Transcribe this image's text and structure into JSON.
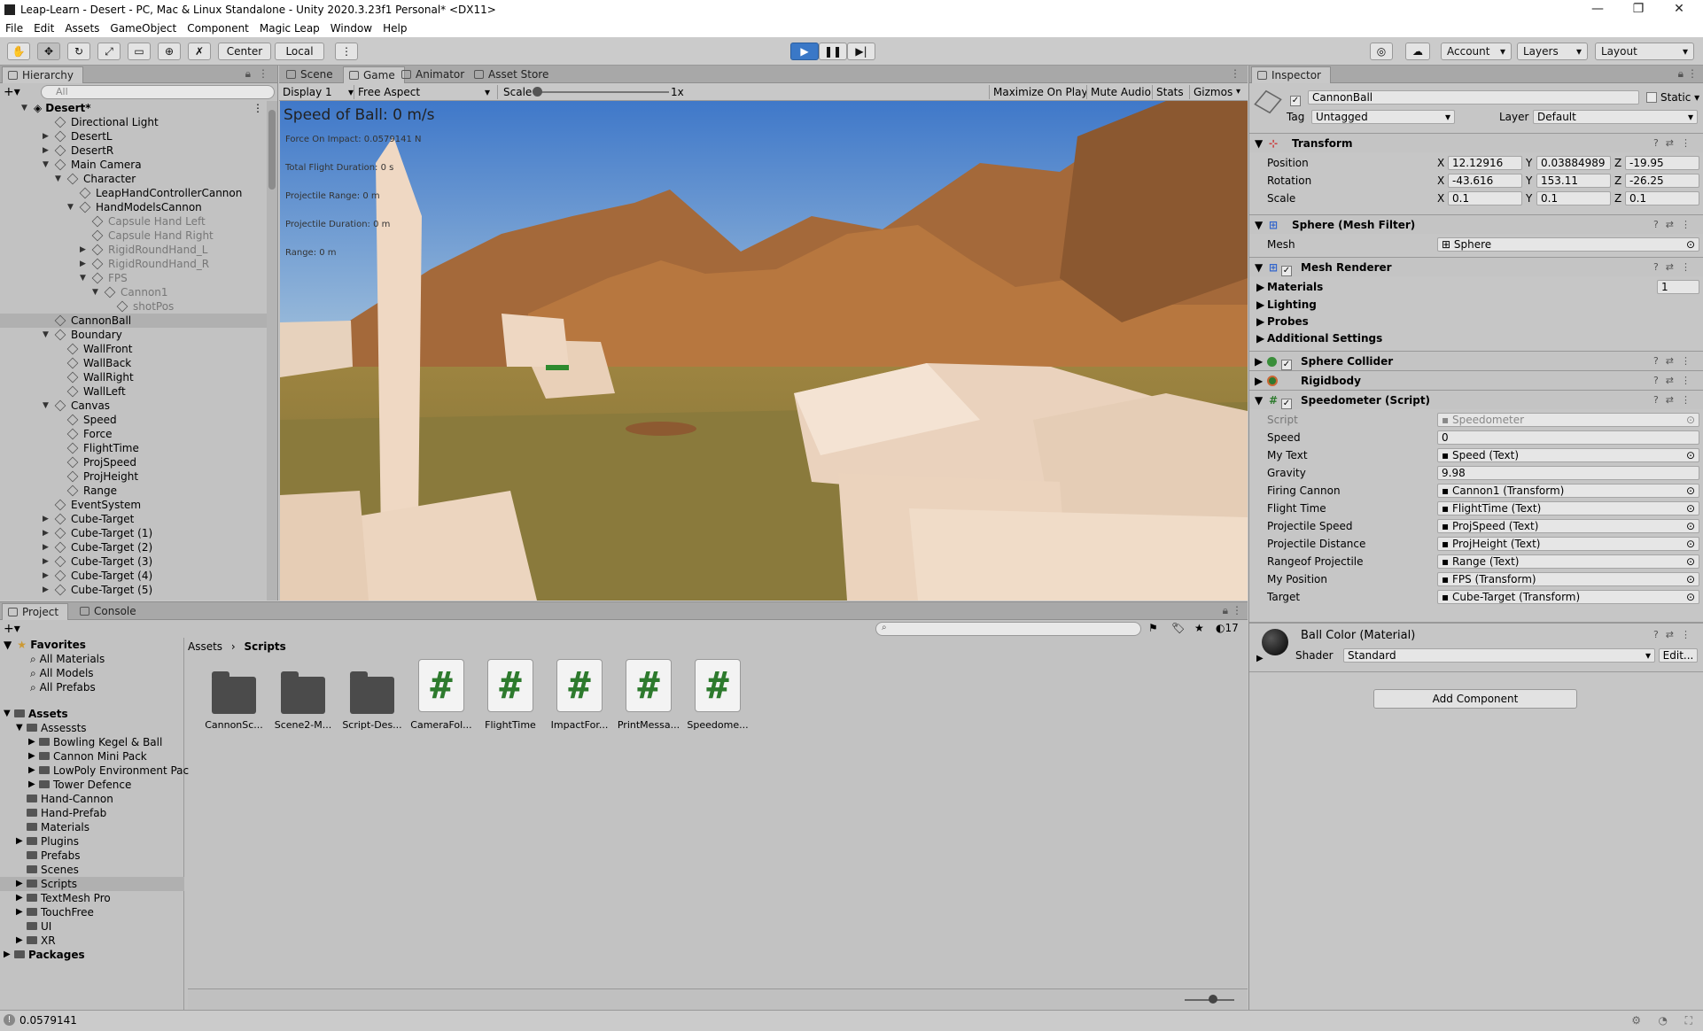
{
  "window": {
    "title": "Leap-Learn - Desert - PC, Mac & Linux Standalone - Unity 2020.3.23f1 Personal* <DX11>"
  },
  "menu": [
    "File",
    "Edit",
    "Assets",
    "GameObject",
    "Component",
    "Magic Leap",
    "Window",
    "Help"
  ],
  "toolbar": {
    "center": "Center",
    "local": "Local",
    "account": "Account",
    "layers": "Layers",
    "layout": "Layout"
  },
  "hierarchy": {
    "tab": "Hierarchy",
    "search_placeholder": "All",
    "rows": [
      {
        "label": "Desert*",
        "indent": 0,
        "bold": true,
        "arrow": "▼"
      },
      {
        "label": "Directional Light",
        "indent": 1
      },
      {
        "label": "DesertL",
        "indent": 1,
        "arrow": "▶"
      },
      {
        "label": "DesertR",
        "indent": 1,
        "arrow": "▶"
      },
      {
        "label": "Main Camera",
        "indent": 1,
        "arrow": "▼"
      },
      {
        "label": "Character",
        "indent": 2,
        "arrow": "▼"
      },
      {
        "label": "LeapHandControllerCannon",
        "indent": 3
      },
      {
        "label": "HandModelsCannon",
        "indent": 3,
        "arrow": "▼"
      },
      {
        "label": "Capsule Hand Left",
        "indent": 4,
        "grey": true
      },
      {
        "label": "Capsule Hand Right",
        "indent": 4,
        "grey": true
      },
      {
        "label": "RigidRoundHand_L",
        "indent": 4,
        "grey": true,
        "arrow": "▶"
      },
      {
        "label": "RigidRoundHand_R",
        "indent": 4,
        "grey": true,
        "arrow": "▶"
      },
      {
        "label": "FPS",
        "indent": 4,
        "grey": true,
        "arrow": "▼"
      },
      {
        "label": "Cannon1",
        "indent": 5,
        "grey": true,
        "arrow": "▼"
      },
      {
        "label": "shotPos",
        "indent": 6,
        "grey": true
      },
      {
        "label": "CannonBall",
        "indent": 1,
        "selected": true
      },
      {
        "label": "Boundary",
        "indent": 1,
        "arrow": "▼"
      },
      {
        "label": "WallFront",
        "indent": 2
      },
      {
        "label": "WallBack",
        "indent": 2
      },
      {
        "label": "WallRight",
        "indent": 2
      },
      {
        "label": "WallLeft",
        "indent": 2
      },
      {
        "label": "Canvas",
        "indent": 1,
        "arrow": "▼"
      },
      {
        "label": "Speed",
        "indent": 2
      },
      {
        "label": "Force",
        "indent": 2
      },
      {
        "label": "FlightTime",
        "indent": 2
      },
      {
        "label": "ProjSpeed",
        "indent": 2
      },
      {
        "label": "ProjHeight",
        "indent": 2
      },
      {
        "label": "Range",
        "indent": 2
      },
      {
        "label": "EventSystem",
        "indent": 1
      },
      {
        "label": "Cube-Target",
        "indent": 1,
        "arrow": "▶"
      },
      {
        "label": "Cube-Target (1)",
        "indent": 1,
        "arrow": "▶"
      },
      {
        "label": "Cube-Target (2)",
        "indent": 1,
        "arrow": "▶"
      },
      {
        "label": "Cube-Target (3)",
        "indent": 1,
        "arrow": "▶"
      },
      {
        "label": "Cube-Target (4)",
        "indent": 1,
        "arrow": "▶"
      },
      {
        "label": "Cube-Target (5)",
        "indent": 1,
        "arrow": "▶"
      }
    ]
  },
  "view_tabs": [
    "Scene",
    "Game",
    "Animator",
    "Asset Store"
  ],
  "game": {
    "display": "Display 1",
    "aspect": "Free Aspect",
    "scale_label": "Scale",
    "scale_value": "1x",
    "maximize": "Maximize On Play",
    "mute": "Mute Audio",
    "stats": "Stats",
    "gizmos": "Gizmos",
    "hud": [
      "Speed of Ball: 0 m/s",
      "Force On Impact: 0.0579141 N",
      "Total Flight Duration: 0 s",
      "Projectile Range: 0 m",
      "Projectile Duration: 0 m",
      "Range: 0 m"
    ]
  },
  "inspector": {
    "tab": "Inspector",
    "object_name": "CannonBall",
    "static": "Static",
    "tag_label": "Tag",
    "tag_value": "Untagged",
    "layer_label": "Layer",
    "layer_value": "Default",
    "transform": {
      "title": "Transform",
      "position": {
        "label": "Position",
        "x": "12.12916",
        "y": "0.03884989",
        "z": "-19.95"
      },
      "rotation": {
        "label": "Rotation",
        "x": "-43.616",
        "y": "153.11",
        "z": "-26.25"
      },
      "scale": {
        "label": "Scale",
        "x": "0.1",
        "y": "0.1",
        "z": "0.1"
      }
    },
    "mesh_filter": {
      "title": "Sphere (Mesh Filter)",
      "mesh_label": "Mesh",
      "mesh_value": "Sphere"
    },
    "mesh_renderer": {
      "title": "Mesh Renderer",
      "materials": "Materials",
      "materials_count": "1",
      "lighting": "Lighting",
      "probes": "Probes",
      "additional": "Additional Settings"
    },
    "sphere_collider": "Sphere Collider",
    "rigidbody": "Rigidbody",
    "speedometer": {
      "title": "Speedometer (Script)",
      "fields": [
        {
          "label": "Script",
          "value": "Speedometer",
          "grey": true
        },
        {
          "label": "Speed",
          "value": "0"
        },
        {
          "label": "My Text",
          "value": "Speed (Text)",
          "obj": true
        },
        {
          "label": "Gravity",
          "value": "9.98"
        },
        {
          "label": "Firing Cannon",
          "value": "Cannon1 (Transform)",
          "obj": true
        },
        {
          "label": "Flight Time",
          "value": "FlightTime (Text)",
          "obj": true
        },
        {
          "label": "Projectile Speed",
          "value": "ProjSpeed (Text)",
          "obj": true
        },
        {
          "label": "Projectile Distance",
          "value": "ProjHeight (Text)",
          "obj": true
        },
        {
          "label": "Rangeof Projectile",
          "value": "Range (Text)",
          "obj": true
        },
        {
          "label": "My Position",
          "value": "FPS (Transform)",
          "obj": true
        },
        {
          "label": "Target",
          "value": "Cube-Target (Transform)",
          "obj": true
        }
      ]
    },
    "material": {
      "name": "Ball Color (Material)",
      "shader_label": "Shader",
      "shader_value": "Standard",
      "edit": "Edit..."
    },
    "add_component": "Add Component"
  },
  "project": {
    "tabs": [
      "Project",
      "Console"
    ],
    "badge": "17",
    "favorites": {
      "title": "Favorites",
      "items": [
        "All Materials",
        "All Models",
        "All Prefabs"
      ]
    },
    "assets_tree": [
      {
        "label": "Assets",
        "indent": 0,
        "arrow": "▼",
        "bold": true
      },
      {
        "label": "Assessts",
        "indent": 1,
        "arrow": "▼"
      },
      {
        "label": "Bowling Kegel & Ball",
        "indent": 2,
        "arrow": "▶"
      },
      {
        "label": "Cannon Mini Pack",
        "indent": 2,
        "arrow": "▶"
      },
      {
        "label": "LowPoly Environment Pac",
        "indent": 2,
        "arrow": "▶"
      },
      {
        "label": "Tower Defence",
        "indent": 2,
        "arrow": "▶"
      },
      {
        "label": "Hand-Cannon",
        "indent": 1
      },
      {
        "label": "Hand-Prefab",
        "indent": 1
      },
      {
        "label": "Materials",
        "indent": 1
      },
      {
        "label": "Plugins",
        "indent": 1,
        "arrow": "▶"
      },
      {
        "label": "Prefabs",
        "indent": 1
      },
      {
        "label": "Scenes",
        "indent": 1
      },
      {
        "label": "Scripts",
        "indent": 1,
        "arrow": "▶",
        "selected": true
      },
      {
        "label": "TextMesh Pro",
        "indent": 1,
        "arrow": "▶"
      },
      {
        "label": "TouchFree",
        "indent": 1,
        "arrow": "▶"
      },
      {
        "label": "UI",
        "indent": 1
      },
      {
        "label": "XR",
        "indent": 1,
        "arrow": "▶"
      },
      {
        "label": "Packages",
        "indent": 0,
        "arrow": "▶",
        "bold": true
      }
    ],
    "breadcrumb": [
      "Assets",
      "Scripts"
    ],
    "items": [
      {
        "label": "CannonSc...",
        "kind": "folder"
      },
      {
        "label": "Scene2-M...",
        "kind": "folder"
      },
      {
        "label": "Script-Des...",
        "kind": "folder"
      },
      {
        "label": "CameraFol...",
        "kind": "script"
      },
      {
        "label": "FlightTime",
        "kind": "script"
      },
      {
        "label": "ImpactFor...",
        "kind": "script"
      },
      {
        "label": "PrintMessa...",
        "kind": "script"
      },
      {
        "label": "Speedome...",
        "kind": "script"
      }
    ]
  },
  "status": {
    "text": "0.0579141"
  },
  "colors": {
    "accent": "#3a78c7",
    "selected_row": "#b0b0b0",
    "script_hash": "#2d7a2d"
  }
}
